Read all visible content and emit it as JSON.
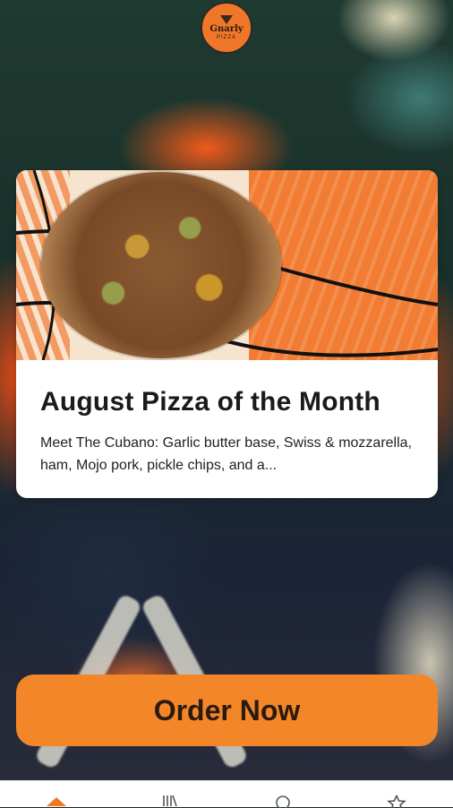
{
  "logo": {
    "name": "Gnarly",
    "sub": "PIZZA"
  },
  "promo": {
    "title": "August Pizza of the Month",
    "description": "Meet The Cubano: Garlic butter base, Swiss & mozzarella, ham, Mojo pork, pickle chips, and a..."
  },
  "order_button": {
    "label": "Order Now"
  },
  "bottom_nav": {
    "items": [
      {
        "icon": "home-icon",
        "active": true
      },
      {
        "icon": "menu-icon",
        "active": false
      },
      {
        "icon": "search-icon",
        "active": false
      },
      {
        "icon": "star-icon",
        "active": false
      }
    ]
  },
  "colors": {
    "accent": "#f28629",
    "nav_active": "#f07a22",
    "card_bg": "#ffffff"
  }
}
